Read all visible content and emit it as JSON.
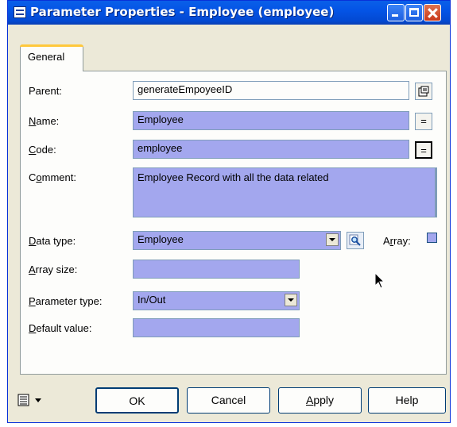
{
  "window": {
    "title": "Parameter Properties - Employee (employee)"
  },
  "tabs": [
    {
      "label": "General"
    }
  ],
  "form": {
    "parent": {
      "label": "Parent:",
      "value": "generateEmpoyeeID"
    },
    "name": {
      "label_accel": "N",
      "label_rest": "ame:",
      "value": "Employee",
      "button": "="
    },
    "code": {
      "label_accel": "C",
      "label_rest": "ode:",
      "value": "employee",
      "button": "="
    },
    "comment": {
      "label_pre": "C",
      "label_accel": "o",
      "label_rest": "mment:",
      "value": "Employee Record with all the data related"
    },
    "data_type": {
      "label_accel": "D",
      "label_rest": "ata type:",
      "value": "Employee"
    },
    "array": {
      "label_pre": "A",
      "label_accel": "r",
      "label_rest": "ray:",
      "checked": false
    },
    "array_size": {
      "label_accel": "A",
      "label_rest": "rray size:",
      "value": ""
    },
    "parameter_type": {
      "label_accel": "P",
      "label_rest": "arameter type:",
      "value": "In/Out"
    },
    "default_value": {
      "label_accel": "D",
      "label_rest": "efault value:",
      "value": ""
    }
  },
  "buttons": {
    "ok": "OK",
    "cancel": "Cancel",
    "apply_accel": "A",
    "apply_rest": "pply",
    "help": "Help"
  },
  "icons": {
    "title": "property-sheet-icon",
    "parent_properties": "properties-icon",
    "browse": "search-icon",
    "menu": "list-menu-icon"
  },
  "colors": {
    "titlebar": "#0454e6",
    "field_fill": "#a3a7ee",
    "close_button": "#d4492a",
    "dialog_background": "#ece9d8"
  }
}
